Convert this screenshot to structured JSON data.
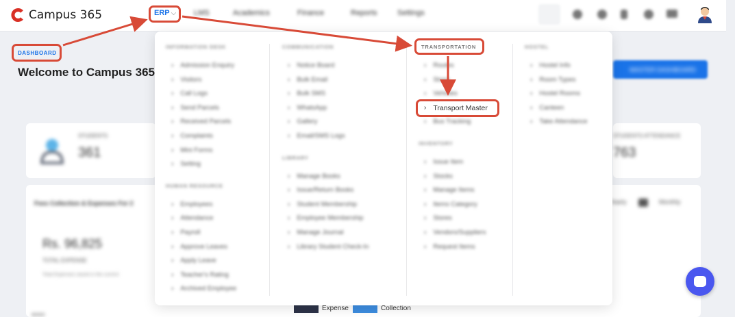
{
  "app": {
    "name": "Campus 365",
    "brand_color": "#d93025"
  },
  "nav": {
    "erp_label": "ERP",
    "chevron": "⌵",
    "items": [
      "LMS",
      "Academics",
      "Finance",
      "Reports",
      "Settings"
    ]
  },
  "icons": {
    "search": "search-icon",
    "top": [
      "globe-icon",
      "notification-icon",
      "bell-icon",
      "help-icon",
      "grid-icon"
    ]
  },
  "page": {
    "breadcrumb": "DASHBOARD",
    "welcome": "Welcome to Campus 365 I",
    "master_button": "MASTER DASHBOARD",
    "stats": {
      "students_label": "STUDENTS",
      "students_value": "361",
      "attendance_label": "STUDENTS ATTENDANCE",
      "attendance_value": "763"
    },
    "fees": {
      "title": "Fees Collection & Expenses For 2",
      "amount": "Rs. 96,825",
      "amount_label": "TOTAL EXPENSE",
      "note": "Total Expenses raised in the current",
      "period_year": "Yearly",
      "period_month": "Monthly",
      "axis_tick": "80000"
    },
    "legend": {
      "expense": "Expense",
      "collection": "Collection",
      "expense_color": "#2d3348",
      "collection_color": "#3d8de0"
    }
  },
  "dropdown": {
    "columns": [
      {
        "sections": [
          {
            "heading": "INFORMATION DESK",
            "items": [
              "Admission Enquiry",
              "Visitors",
              "Call Logs",
              "Send Parcels",
              "Received Parcels",
              "Complaints",
              "Mini Forms",
              "Setting"
            ]
          },
          {
            "heading": "HUMAN RESOURCE",
            "items": [
              "Employees",
              "Attendance",
              "Payroll",
              "Approve Leaves",
              "Apply Leave",
              "Teacher's Rating",
              "Archived Employee"
            ]
          }
        ]
      },
      {
        "sections": [
          {
            "heading": "COMMUNICATION",
            "items": [
              "Notice Board",
              "Bulk Email",
              "Bulk SMS",
              "WhatsApp",
              "Gallery",
              "Email/SMS Logs"
            ]
          },
          {
            "heading": "LIBRARY",
            "items": [
              "Manage Books",
              "Issue/Return Books",
              "Student Membership",
              "Employee Membership",
              "Manage Journal",
              "Library Student Check-In"
            ]
          }
        ]
      },
      {
        "sections": [
          {
            "heading": "TRANSPORTATION",
            "items": [
              "Routes",
              "Stops",
              "Vehicles",
              "Transport Master",
              "Bus Tracking"
            ],
            "highlight_index": 3
          },
          {
            "heading": "INVENTORY",
            "items": [
              "Issue Item",
              "Stocks",
              "Manage Items",
              "Items Category",
              "Stores",
              "Vendors/Suppliers",
              "Request Items"
            ]
          }
        ]
      },
      {
        "sections": [
          {
            "heading": "HOSTEL",
            "items": [
              "Hostel Info",
              "Room Types",
              "Hostel Rooms",
              "Canteen",
              "Take Attendance"
            ]
          }
        ]
      }
    ]
  },
  "annotation": {
    "color": "#d84a37"
  }
}
